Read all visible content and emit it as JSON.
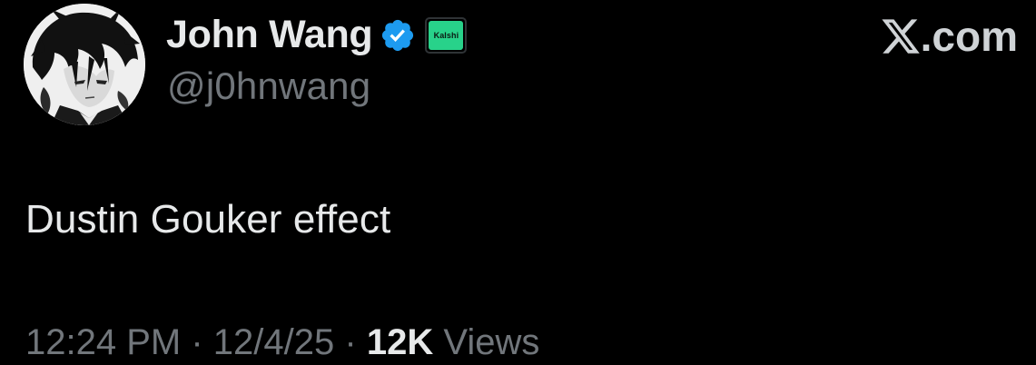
{
  "author": {
    "display_name": "John Wang",
    "handle": "@j0hnwang",
    "verified": true,
    "verified_color": "#1d9bf0",
    "affiliate_badge": {
      "label": "Kalshi",
      "color": "#28d28a"
    }
  },
  "site": {
    "logo_icon": "x-logo-icon",
    "domain": ".com"
  },
  "tweet": {
    "text": "Dustin Gouker effect"
  },
  "meta": {
    "time": "12:24 PM",
    "separator": "·",
    "date": "12/4/25",
    "views_count": "12K",
    "views_label": "Views"
  },
  "colors": {
    "background": "#000000",
    "primary_text": "#e7e9ea",
    "secondary_text": "#71767b"
  }
}
